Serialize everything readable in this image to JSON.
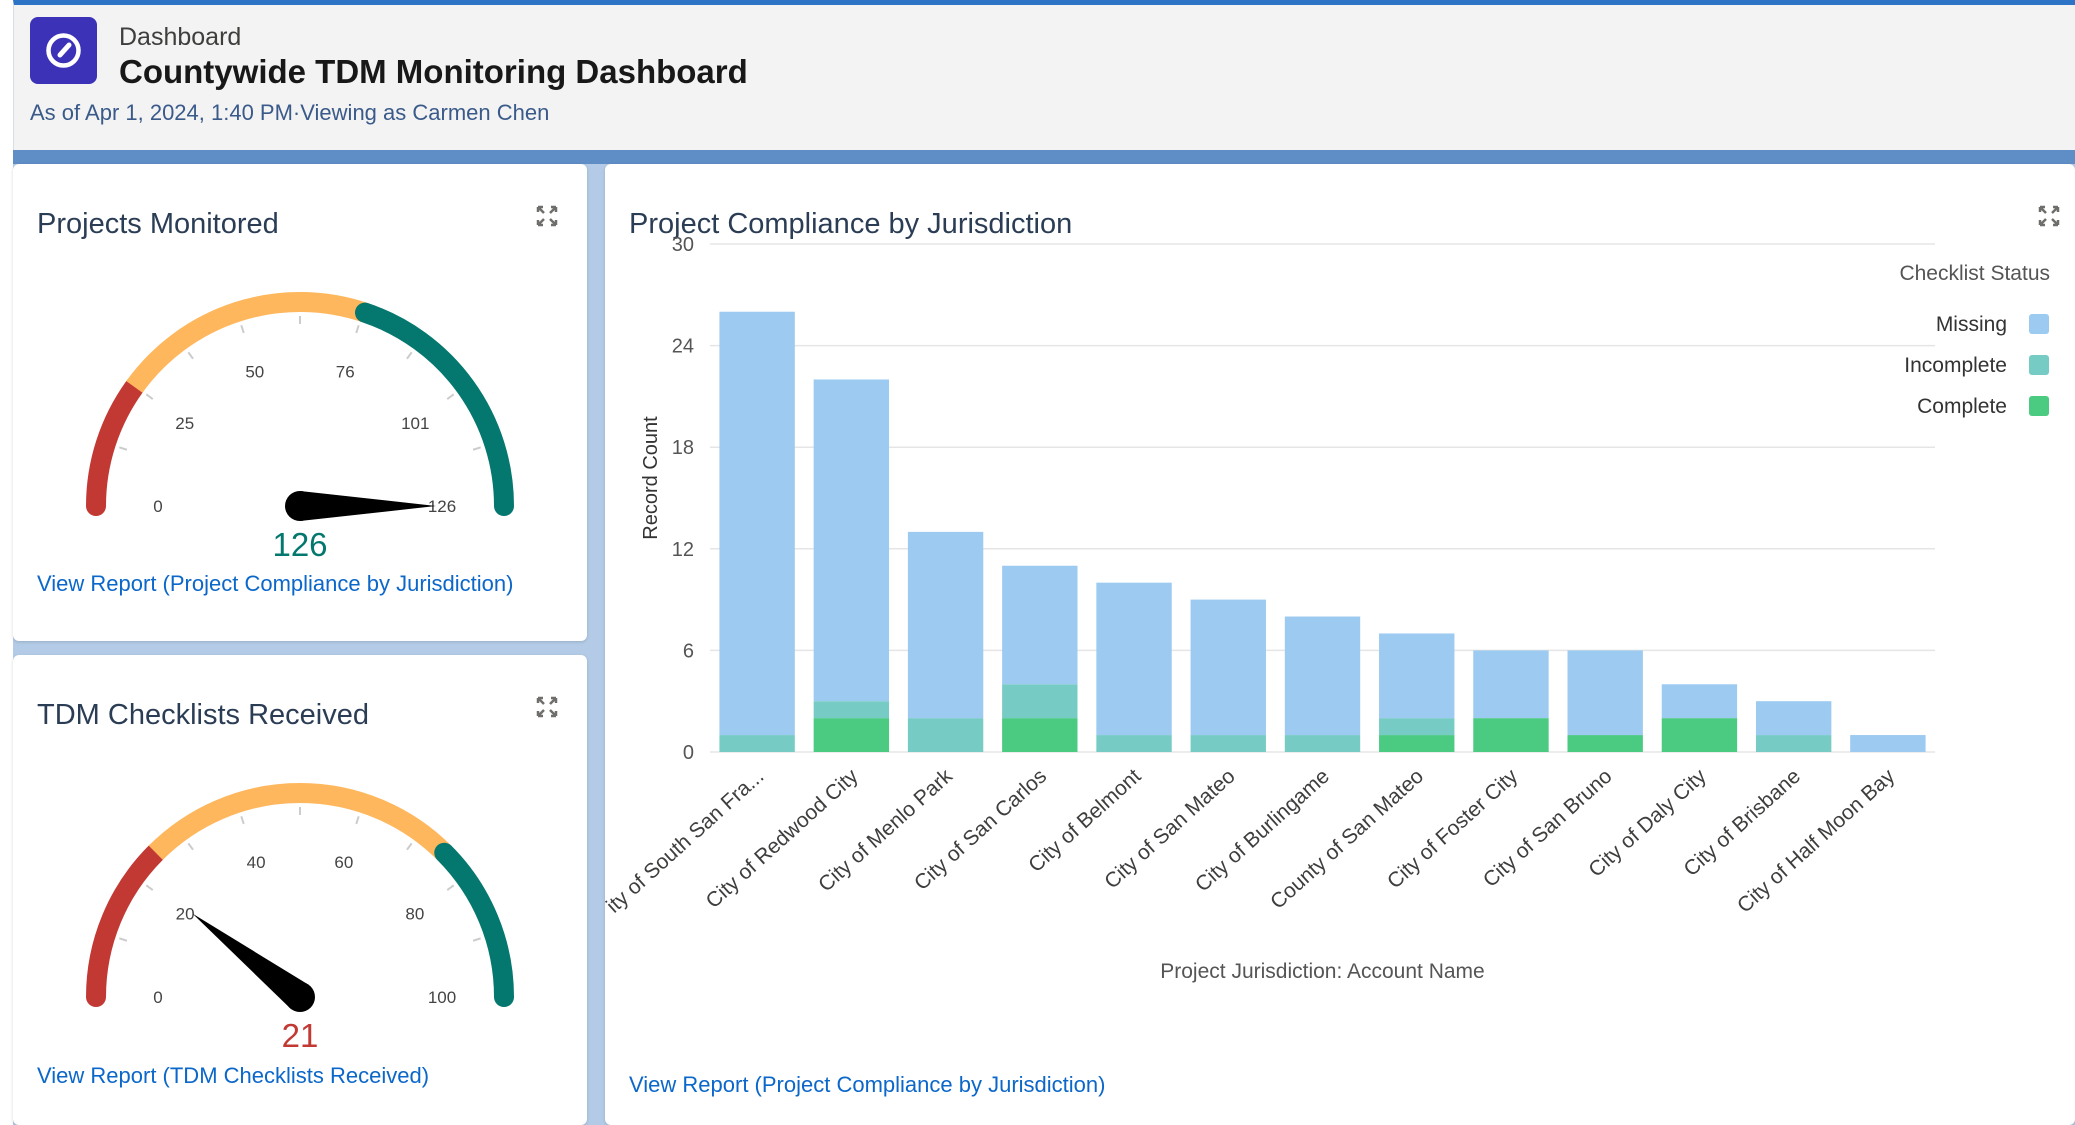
{
  "header": {
    "breadcrumb": "Dashboard",
    "title": "Countywide TDM Monitoring Dashboard",
    "meta": "As of Apr 1, 2024, 1:40 PM·Viewing as Carmen Chen",
    "logo_icon": "dashboard-gauge-icon",
    "accent": "#3b32b8"
  },
  "widgets": {
    "projects": {
      "title": "Projects Monitored",
      "link": "View Report (Project Compliance by Jurisdiction)",
      "gauge": {
        "min": 0,
        "max": 126,
        "value": 126,
        "value_label": "126",
        "ticks": [
          0,
          25,
          50,
          76,
          101,
          126
        ],
        "bands": [
          {
            "from": 0,
            "to": 25,
            "color": "#c23934"
          },
          {
            "from": 25,
            "to": 76,
            "color": "#ffb75d"
          },
          {
            "from": 76,
            "to": 126,
            "color": "#04776f"
          }
        ],
        "value_color": "#04776f"
      }
    },
    "checklists": {
      "title": "TDM Checklists Received",
      "link": "View Report (TDM Checklists Received)",
      "gauge": {
        "min": 0,
        "max": 100,
        "value": 21,
        "value_label": "21",
        "ticks": [
          0,
          20,
          40,
          60,
          80,
          100
        ],
        "bands": [
          {
            "from": 0,
            "to": 25,
            "color": "#c23934"
          },
          {
            "from": 25,
            "to": 75,
            "color": "#ffb75d"
          },
          {
            "from": 75,
            "to": 100,
            "color": "#04776f"
          }
        ],
        "value_color": "#c23934"
      }
    },
    "compliance": {
      "title": "Project Compliance by Jurisdiction",
      "link": "View Report (Project Compliance by Jurisdiction)"
    }
  },
  "chart_data": {
    "type": "bar",
    "stacked": true,
    "title": "Project Compliance by Jurisdiction",
    "xlabel": "Project Jurisdiction: Account Name",
    "ylabel": "Record Count",
    "ylim": [
      0,
      30
    ],
    "yticks": [
      0,
      6,
      12,
      18,
      24,
      30
    ],
    "grid": true,
    "legend_title": "Checklist Status",
    "legend_position": "top-right",
    "categories": [
      "ity of South San Fra...",
      "City of Redwood City",
      "City of Menlo Park",
      "City of San Carlos",
      "City of Belmont",
      "City of San Mateo",
      "City of Burlingame",
      "County of San Mateo",
      "City of Foster City",
      "City of San Bruno",
      "City of Daly City",
      "City of Brisbane",
      "City of Half Moon Bay"
    ],
    "series": [
      {
        "name": "Complete",
        "color": "#4bca81",
        "values": [
          0,
          2,
          0,
          2,
          0,
          0,
          0,
          1,
          2,
          1,
          2,
          0,
          0
        ]
      },
      {
        "name": "Incomplete",
        "color": "#76ccc4",
        "values": [
          1,
          1,
          2,
          2,
          1,
          1,
          1,
          1,
          0,
          0,
          0,
          1,
          0
        ]
      },
      {
        "name": "Missing",
        "color": "#9ccaf1",
        "values": [
          25,
          19,
          11,
          7,
          9,
          8,
          7,
          5,
          4,
          5,
          2,
          2,
          1
        ]
      }
    ]
  }
}
